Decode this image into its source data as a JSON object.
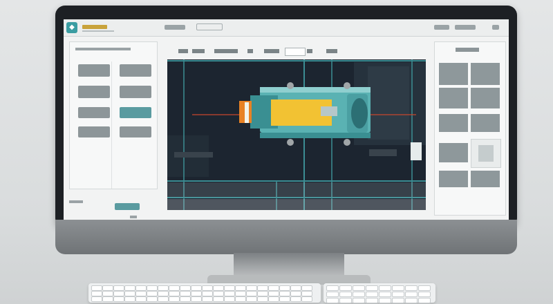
{
  "app": {
    "brand_text": "",
    "title_text": ""
  },
  "colors": {
    "accent_teal": "#3b9da2",
    "accent_yellow": "#f2c233",
    "accent_orange": "#e88224",
    "viewport_bg": "#1c2530",
    "ui_gray": "#8e989b"
  },
  "icons": {
    "logo": "app-logo-icon"
  },
  "viewport": {
    "left_label": "",
    "right_label": ""
  },
  "status": {
    "left": "",
    "button": ""
  }
}
